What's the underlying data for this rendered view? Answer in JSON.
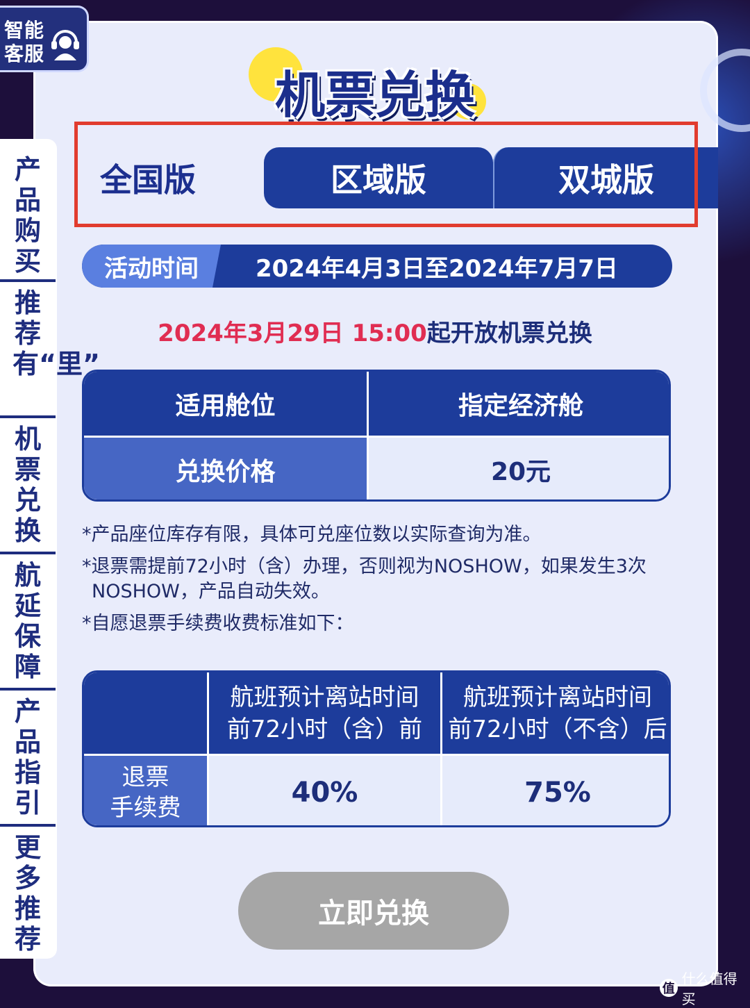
{
  "service_badge": {
    "text": "智能客服",
    "icon": "customer-service-icon"
  },
  "title": "机票兑换",
  "side_nav": [
    {
      "label": "产品购买"
    },
    {
      "label": "推荐有“里”"
    },
    {
      "label": "机票兑换"
    },
    {
      "label": "航延保障"
    },
    {
      "label": "产品指引"
    },
    {
      "label": "更多推荐"
    }
  ],
  "tabs": [
    {
      "label": "全国版",
      "active": true
    },
    {
      "label": "区域版",
      "active": false
    },
    {
      "label": "双城版",
      "active": false
    }
  ],
  "activity": {
    "label": "活动时间",
    "value": "2024年4月3日至2024年7月7日"
  },
  "open_notice": {
    "highlight": "2024年3月29日 15:00",
    "rest": "起开放机票兑换"
  },
  "info_table": {
    "rows": [
      {
        "label": "适用舱位",
        "value": "指定经济舱"
      },
      {
        "label": "兑换价格",
        "value": "20元"
      }
    ]
  },
  "notes": [
    "*产品座位库存有限，具体可兑座位数以实际查询为准。",
    "*退票需提前72小时（含）办理，否则视为NOSHOW，如果发生3次",
    "NOSHOW，产品自动失效。",
    "*自愿退票手续费收费标准如下："
  ],
  "fee_table": {
    "col1": [
      "航班预计离站时间",
      "前72小时（含）前"
    ],
    "col2": [
      "航班预计离站时间",
      "前72小时（不含）后"
    ],
    "row_label": [
      "退票",
      "手续费"
    ],
    "values": [
      "40%",
      "75%"
    ]
  },
  "redeem_button": {
    "label": "立即兑换"
  },
  "watermark": {
    "icon_text": "值",
    "text": "什么值得买"
  },
  "colors": {
    "primary": "#1d3c9b",
    "accent_red": "#e02d52",
    "highlight_box": "#e13c2e",
    "title_blob": "#ffe33d"
  }
}
